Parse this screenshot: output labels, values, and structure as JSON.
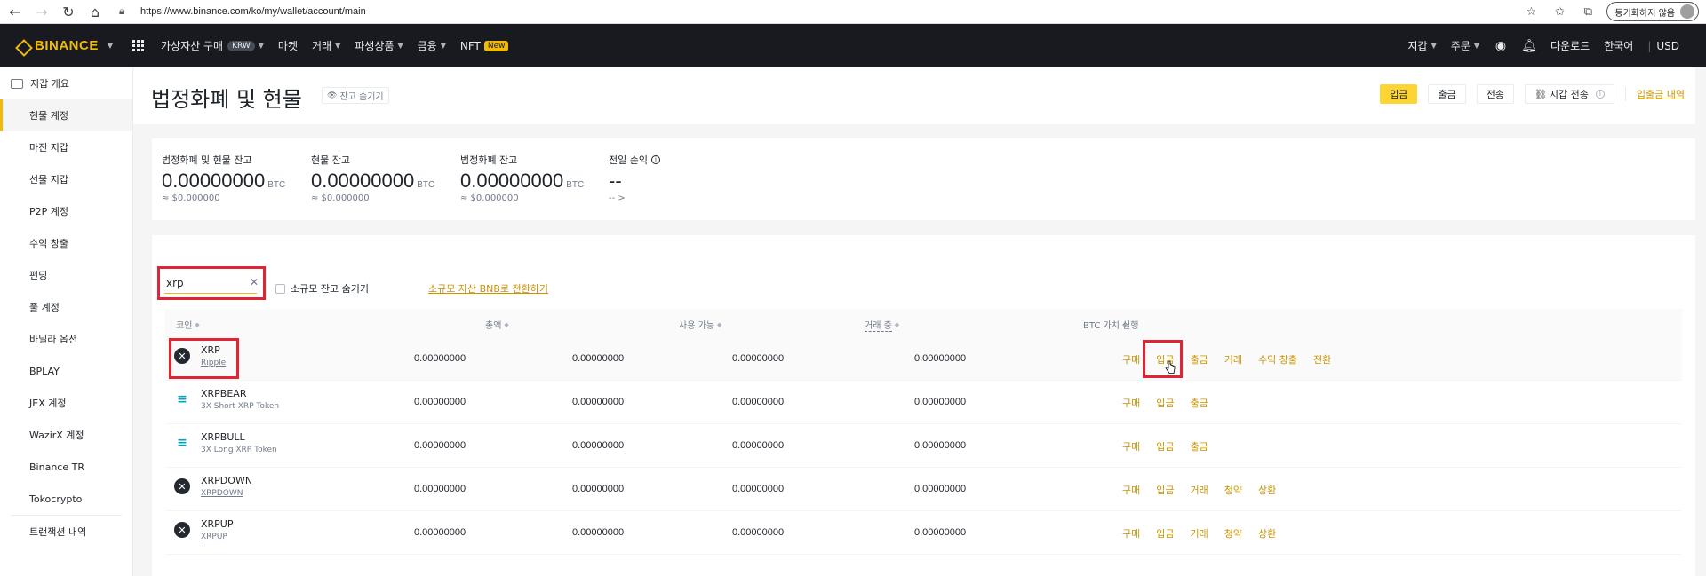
{
  "browser": {
    "url": "https://www.binance.com/ko/my/wallet/account/main",
    "profile_label": "동기화하지 않음"
  },
  "header": {
    "logo": "BINANCE",
    "nav": [
      {
        "label": "가상자산 구매",
        "badge": "KRW",
        "caret": true
      },
      {
        "label": "마켓",
        "caret": false
      },
      {
        "label": "거래",
        "caret": true
      },
      {
        "label": "파생상품",
        "caret": true
      },
      {
        "label": "금융",
        "caret": true
      },
      {
        "label": "NFT",
        "badge": "New",
        "caret": false
      }
    ],
    "right": {
      "wallet": "지갑",
      "orders": "주문",
      "download": "다운로드",
      "language": "한국어",
      "currency": "USD"
    }
  },
  "sidebar": {
    "items": [
      "지갑 개요",
      "현물 계정",
      "마진 지갑",
      "선물 지갑",
      "P2P 계정",
      "수익 창출",
      "펀딩",
      "풀 계정",
      "바닐라 옵션",
      "BPLAY",
      "JEX 계정",
      "WazirX 계정",
      "Binance TR",
      "Tokocrypto",
      "트랜잭션 내역"
    ],
    "active_index": 1
  },
  "page": {
    "title": "법정화폐 및 현물",
    "hide_balance": "잔고 숨기기",
    "actions": {
      "deposit": "입금",
      "withdraw": "출금",
      "transfer": "전송",
      "wallet_transfer": "지갑 전송",
      "history": "입출금 내역"
    }
  },
  "balances": {
    "total": {
      "label": "법정화폐 및 현물 잔고",
      "value": "0.00000000",
      "unit": "BTC",
      "approx": "≈ $0.000000"
    },
    "spot": {
      "label": "현물 잔고",
      "value": "0.00000000",
      "unit": "BTC",
      "approx": "≈ $0.000000"
    },
    "fiat": {
      "label": "법정화폐 잔고",
      "value": "0.00000000",
      "unit": "BTC",
      "approx": "≈ $0.000000"
    },
    "pnl": {
      "label": "전일 손익",
      "value": "--",
      "sub": "-- >"
    }
  },
  "filters": {
    "search_value": "xrp",
    "hide_small": "소규모 잔고 숨기기",
    "convert_small": "소규모 자산 BNB로 전환하기"
  },
  "table": {
    "headers": {
      "coin": "코인",
      "total": "총액",
      "available": "사용 가능",
      "in_order": "거래 중",
      "btc_value": "BTC 가치",
      "action": "실행"
    },
    "rows": [
      {
        "symbol": "XRP",
        "name": "Ripple",
        "icon": "x-circle",
        "total": "0.00000000",
        "available": "0.00000000",
        "in_order": "0.00000000",
        "btc": "0.00000000",
        "actions": [
          "구매",
          "입금",
          "출금",
          "거래",
          "수익 창출",
          "전환"
        ]
      },
      {
        "symbol": "XRPBEAR",
        "name": "3X Short XRP Token",
        "icon": "ftx",
        "total": "0.00000000",
        "available": "0.00000000",
        "in_order": "0.00000000",
        "btc": "0.00000000",
        "actions": [
          "구매",
          "입금",
          "출금"
        ]
      },
      {
        "symbol": "XRPBULL",
        "name": "3X Long XRP Token",
        "icon": "ftx",
        "total": "0.00000000",
        "available": "0.00000000",
        "in_order": "0.00000000",
        "btc": "0.00000000",
        "actions": [
          "구매",
          "입금",
          "출금"
        ]
      },
      {
        "symbol": "XRPDOWN",
        "name": "XRPDOWN",
        "icon": "x-circle",
        "total": "0.00000000",
        "available": "0.00000000",
        "in_order": "0.00000000",
        "btc": "0.00000000",
        "actions": [
          "구매",
          "입금",
          "거래",
          "청약",
          "상환"
        ]
      },
      {
        "symbol": "XRPUP",
        "name": "XRPUP",
        "icon": "x-circle",
        "total": "0.00000000",
        "available": "0.00000000",
        "in_order": "0.00000000",
        "btc": "0.00000000",
        "actions": [
          "구매",
          "입금",
          "거래",
          "청약",
          "상환"
        ]
      }
    ]
  },
  "colors": {
    "accent": "#f0b90b",
    "header_bg": "#181a20",
    "highlight": "#e02434",
    "link": "#c99400"
  }
}
